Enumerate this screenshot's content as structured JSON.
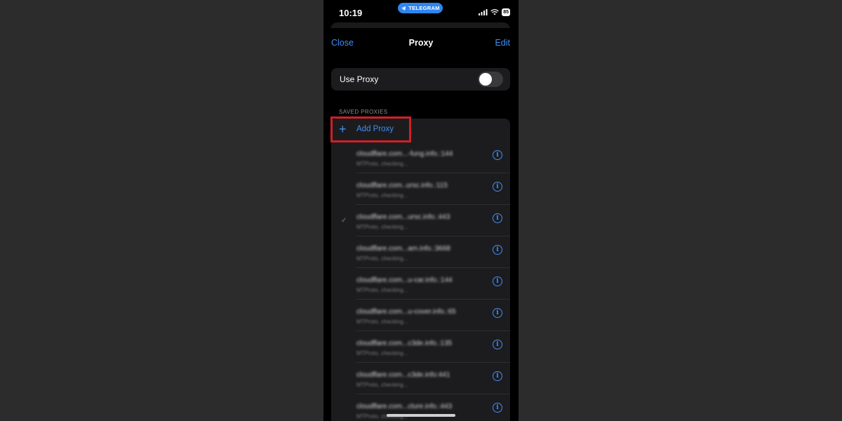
{
  "status_bar": {
    "time": "10:19",
    "app_pill": "TELEGRAM",
    "battery": "85"
  },
  "nav": {
    "close": "Close",
    "title": "Proxy",
    "edit": "Edit"
  },
  "toggle_row": {
    "label": "Use Proxy",
    "enabled": false
  },
  "section": {
    "header": "SAVED PROXIES"
  },
  "add_proxy": {
    "label": "Add Proxy"
  },
  "proxies": [
    {
      "name": "cloudflare.com...-fung.info.:144",
      "status": "MTProto, checking..."
    },
    {
      "name": "cloudflare.com..ursc.info.:115",
      "status": "MTProto, checking..."
    },
    {
      "name": "cloudflare.com...ursc.info.:443",
      "status": "MTProto, checking...",
      "selected": true
    },
    {
      "name": "cloudflare.com...am.info.:3668",
      "status": "MTProto, checking..."
    },
    {
      "name": "cloudflare.com...u-car.info.:144",
      "status": "MTProto, checking..."
    },
    {
      "name": "cloudflare.com...u-cover.info.:65",
      "status": "MTProto, checking..."
    },
    {
      "name": "cloudflare.com...c3de.info.:135",
      "status": "MTProto, checking..."
    },
    {
      "name": "cloudflare.com...c3de.info:441",
      "status": "MTProto, checking..."
    },
    {
      "name": "cloudflare.com...clure.info.:443",
      "status": "MTProto, checking..."
    }
  ],
  "colors": {
    "accent": "#3f8ff5",
    "highlight": "#d11f26",
    "cell_bg": "#1c1c1e"
  }
}
